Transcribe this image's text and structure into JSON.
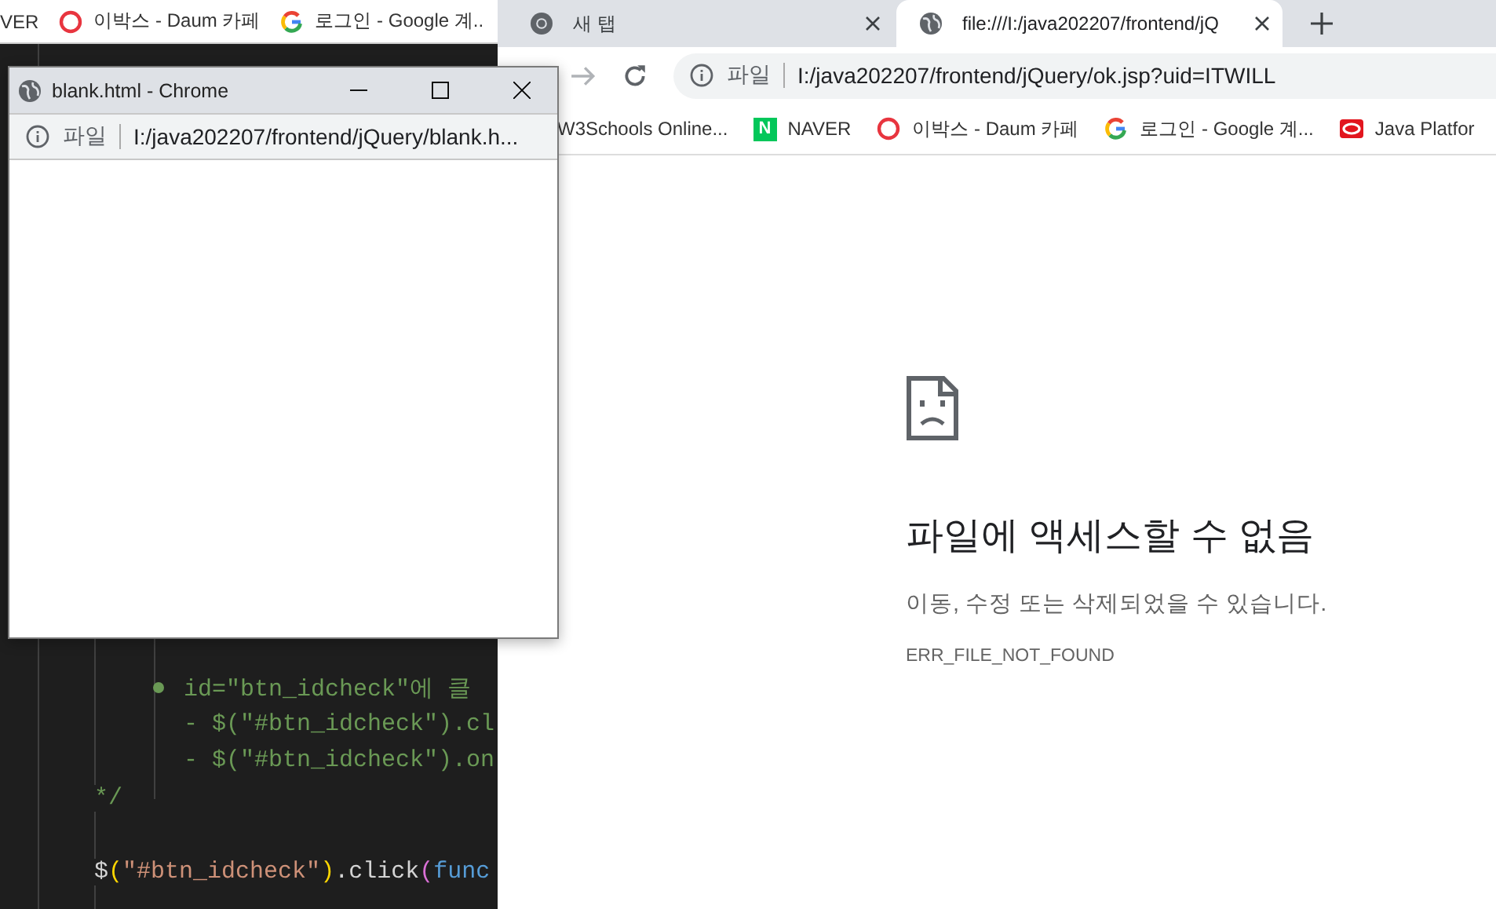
{
  "back_browser": {
    "bookmarks": [
      {
        "label": "VER",
        "kind": "none"
      },
      {
        "label": "이박스 - Daum 카페",
        "kind": "daum"
      },
      {
        "label": "로그인 - Google 계..",
        "kind": "google"
      }
    ]
  },
  "code_editor": {
    "lines": [
      {
        "kind": "blank"
      },
      {
        "kind": "bullet",
        "tokens": [
          {
            "text": "id=\"btn_idcheck\"에 클",
            "kind": "comment"
          }
        ]
      },
      {
        "kind": "item",
        "tokens": [
          {
            "text": "- $(\"#btn_idcheck\").cl",
            "kind": "comment"
          }
        ]
      },
      {
        "kind": "item",
        "tokens": [
          {
            "text": "- $(\"#btn_idcheck\").on",
            "kind": "comment"
          }
        ]
      },
      {
        "kind": "end",
        "tokens": [
          {
            "text": "*/",
            "kind": "comment"
          }
        ]
      },
      {
        "kind": "blank"
      },
      {
        "kind": "code",
        "tokens": [
          {
            "text": "$",
            "kind": "plain"
          },
          {
            "text": "(",
            "kind": "paren"
          },
          {
            "text": "\"#btn_idcheck\"",
            "kind": "string"
          },
          {
            "text": ")",
            "kind": "paren"
          },
          {
            "text": ".click",
            "kind": "plain"
          },
          {
            "text": "(",
            "kind": "paren2"
          },
          {
            "text": "func",
            "kind": "keyword"
          }
        ]
      }
    ]
  },
  "main_browser": {
    "tabs": [
      {
        "title": "새 탭",
        "kind": "home",
        "selected": false
      },
      {
        "title": "file:///I:/java202207/frontend/jQ",
        "kind": "file",
        "selected": true
      }
    ],
    "address": {
      "scheme": "파일",
      "url": "I:/java202207/frontend/jQuery/ok.jsp?uid=ITWILL"
    },
    "bookmarks": [
      {
        "label": "W3Schools Online...",
        "kind": "none"
      },
      {
        "label": "NAVER",
        "kind": "naver",
        "icon_text": "N"
      },
      {
        "label": "이박스 - Daum 카페",
        "kind": "daum"
      },
      {
        "label": "로그인 - Google 계...",
        "kind": "google"
      },
      {
        "label": "Java Platfor",
        "kind": "java"
      }
    ],
    "error_page": {
      "title": "파일에 액세스할 수 없음",
      "message": "이동, 수정 또는 삭제되었을 수 있습니다.",
      "code": "ERR_FILE_NOT_FOUND"
    }
  },
  "popup_window": {
    "title": "blank.html - Chrome",
    "address": {
      "scheme": "파일",
      "url": "I:/java202207/frontend/jQuery/blank.h..."
    }
  }
}
